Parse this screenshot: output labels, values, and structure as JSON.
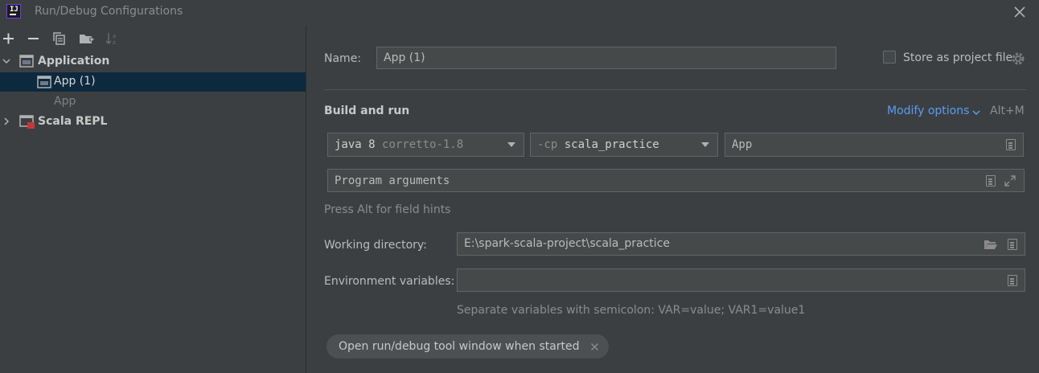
{
  "window": {
    "title": "Run/Debug Configurations"
  },
  "toolbar": {
    "icons": [
      "add-icon",
      "remove-icon",
      "copy-icon",
      "new-folder-icon",
      "sort-icon"
    ]
  },
  "tree": {
    "items": [
      {
        "label": "Application",
        "kind": "group",
        "expanded": true
      },
      {
        "label": "App (1)",
        "kind": "config",
        "selected": true
      },
      {
        "label": "App",
        "kind": "template"
      },
      {
        "label": "Scala REPL",
        "kind": "group",
        "expanded": false
      }
    ]
  },
  "form": {
    "name_label": "Name:",
    "name_value": "App (1)",
    "store_label": "Store as project file",
    "store_checked": false,
    "section_title": "Build and run",
    "modify_options": "Modify options",
    "modify_shortcut": "Alt+M",
    "jdk": {
      "main": "java 8",
      "sub": "corretto-1.8"
    },
    "classpath": {
      "prefix": "-cp",
      "value": "scala_practice"
    },
    "main_class": "App",
    "program_args_placeholder": "Program arguments",
    "field_hint": "Press Alt for field hints",
    "workdir_label": "Working directory:",
    "workdir_value": "E:\\spark-scala-project\\scala_practice",
    "env_label": "Environment variables:",
    "env_value": "",
    "env_hint": "Separate variables with semicolon: VAR=value; VAR1=value1",
    "chip_label": "Open run/debug tool window when started"
  },
  "colors": {
    "background": "#3c3f41",
    "selection": "#0d293e",
    "field": "#45494a",
    "link": "#589df6",
    "text": "#bbbbbb"
  }
}
